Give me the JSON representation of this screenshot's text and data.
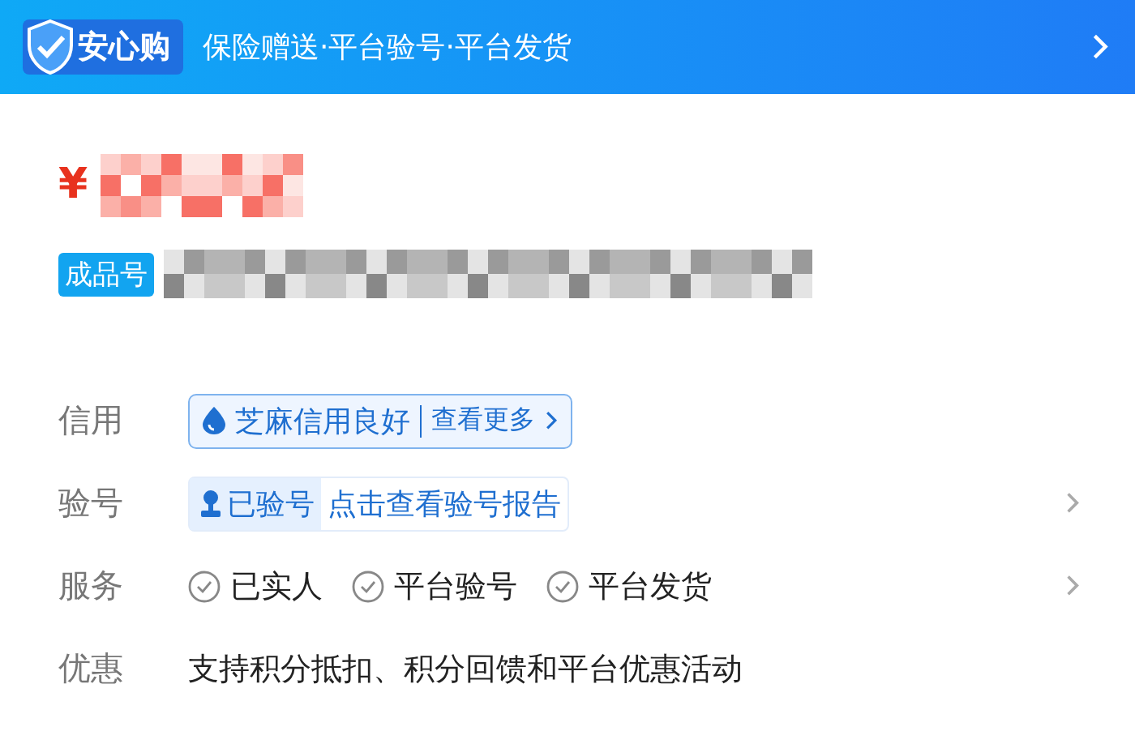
{
  "banner": {
    "badge": "安心购",
    "text": "保险赠送·平台验号·平台发货"
  },
  "price": {
    "currency": "¥"
  },
  "product": {
    "tag": "成品号"
  },
  "rows": [
    {
      "kind": "credit",
      "label": "信用",
      "badge": "芝麻信用良好",
      "link": "查看更多",
      "has_arrow": false
    },
    {
      "kind": "verify",
      "label": "验号",
      "status": "已验号",
      "link": "点击查看验号报告",
      "has_arrow": true
    },
    {
      "kind": "services",
      "label": "服务",
      "items": [
        "已实人",
        "平台验号",
        "平台发货"
      ],
      "has_arrow": true
    },
    {
      "kind": "text",
      "label": "优惠",
      "text": "支持积分抵扣、积分回馈和平台优惠活动",
      "has_arrow": false
    }
  ]
}
